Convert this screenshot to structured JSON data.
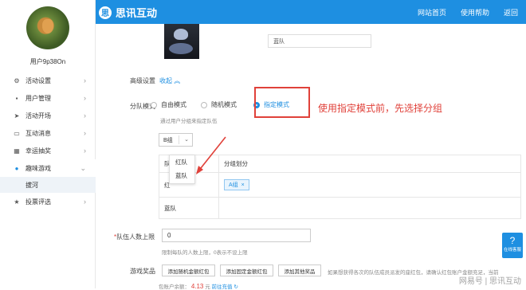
{
  "app": {
    "logo_text": "思讯互动",
    "logo_icon": "思"
  },
  "topnav": {
    "items": [
      "网站首页",
      "使用帮助",
      "返回"
    ]
  },
  "sidebar": {
    "username": "用户9p38On",
    "items": [
      {
        "label": "活动设置",
        "icon": "gear-icon",
        "glyph": "⚙"
      },
      {
        "label": "用户管理",
        "icon": "user-icon",
        "glyph": "👤"
      },
      {
        "label": "活动开场",
        "icon": "send-icon",
        "glyph": "➤"
      },
      {
        "label": "互动消息",
        "icon": "message-icon",
        "glyph": "💬"
      },
      {
        "label": "幸运抽奖",
        "icon": "grid-icon",
        "glyph": "▦"
      },
      {
        "label": "趣味游戏",
        "icon": "game-icon",
        "glyph": "🎮"
      },
      {
        "label": "投票评选",
        "icon": "star-icon",
        "glyph": "★"
      }
    ],
    "sub_item": "拔河"
  },
  "form": {
    "team_input_value": "蓝队",
    "advanced_label": "高级设置",
    "collapse_link": "收起",
    "mode_label": "分队模式",
    "modes": [
      "自由模式",
      "随机模式",
      "指定模式"
    ],
    "selected_mode": "指定模式",
    "annotation": "使用指定模式前，先选择分组",
    "mode_hint": "通过用户分组来指定队伍",
    "group_select_value": "B组",
    "table": {
      "header_col1": "队",
      "header_col2": "分组划分",
      "rows": [
        {
          "team": "红",
          "tag": "A组"
        },
        {
          "team": "蓝队",
          "tag": ""
        }
      ]
    },
    "dropdown_options": [
      "红队",
      "蓝队"
    ],
    "limit_label": "队伍人数上限",
    "limit_required": "*",
    "limit_value": "0",
    "limit_hint": "限制每队的人数上限，0表示不设上限",
    "prize_label": "游戏奖品",
    "prize_buttons": [
      "添加随机金额红包",
      "添加固定金额红包",
      "添加其他奖品"
    ],
    "prize_hint": "如果想获得各次的队伍成员派发的座红包，请确认红包账户金额充足，当前",
    "balance_label": "包账户余额：",
    "balance_value": "4.13",
    "balance_unit": "元",
    "recharge_link": "前往充值"
  },
  "float": {
    "label": "在线客服",
    "glyph": "?"
  },
  "watermark": "网易号 | 思讯互动",
  "colors": {
    "brand": "#1e8fe1",
    "annotation": "#e0413a"
  }
}
